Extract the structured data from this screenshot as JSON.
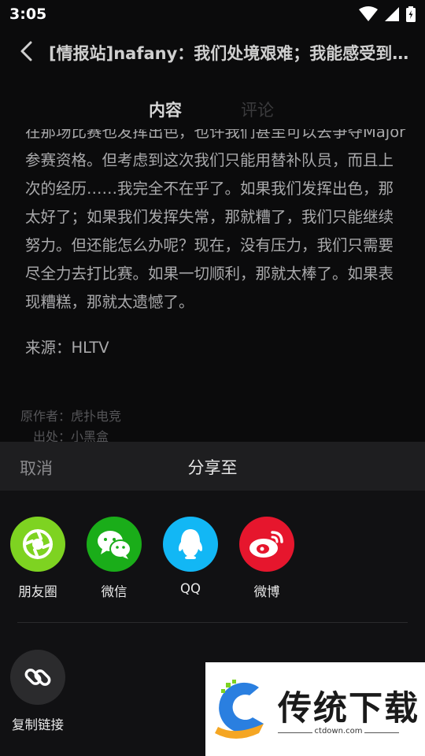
{
  "status_bar": {
    "time": "3:05",
    "icons": [
      "wifi-icon",
      "signal-icon",
      "battery-icon"
    ]
  },
  "header": {
    "back_icon": "chevron-left-icon",
    "title": "[情报站]nafany：我们处境艰难；我能感受到…"
  },
  "tabs": [
    {
      "label": "内容",
      "active": true
    },
    {
      "label": "评论",
      "active": false
    }
  ],
  "article": {
    "lines": "在那场比赛也发挥出色，也许我们甚至可以去争夺Major参赛资格。但考虑到这次我们只能用替补队员，而且上次的经历……我完全不在乎了。如果我们发挥出色，那太好了；如果我们发挥失常，那就糟了，我们只能继续努力。但还能怎么办呢？现在，没有压力，我们只需要尽全力去打比赛。如果一切顺利，那就太棒了。如果表现糟糕，那就太遗憾了。",
    "source": "来源：HLTV",
    "author": "原作者：虎扑电竞",
    "origin": "出处：小黑盒"
  },
  "share_sheet": {
    "cancel_label": "取消",
    "title": "分享至",
    "items": [
      {
        "label": "朋友圈",
        "icon": "moments-icon",
        "color": "#7ed321"
      },
      {
        "label": "微信",
        "icon": "wechat-icon",
        "color": "#1aad19"
      },
      {
        "label": "QQ",
        "icon": "qq-icon",
        "color": "#12b7f5"
      },
      {
        "label": "微博",
        "icon": "weibo-icon",
        "color": "#e6162d"
      }
    ],
    "copy_link": {
      "label": "复制链接",
      "icon": "link-icon",
      "color": "#2b2b2d"
    }
  },
  "watermark": {
    "brand": "传统下载",
    "url": "ctdown.com"
  }
}
